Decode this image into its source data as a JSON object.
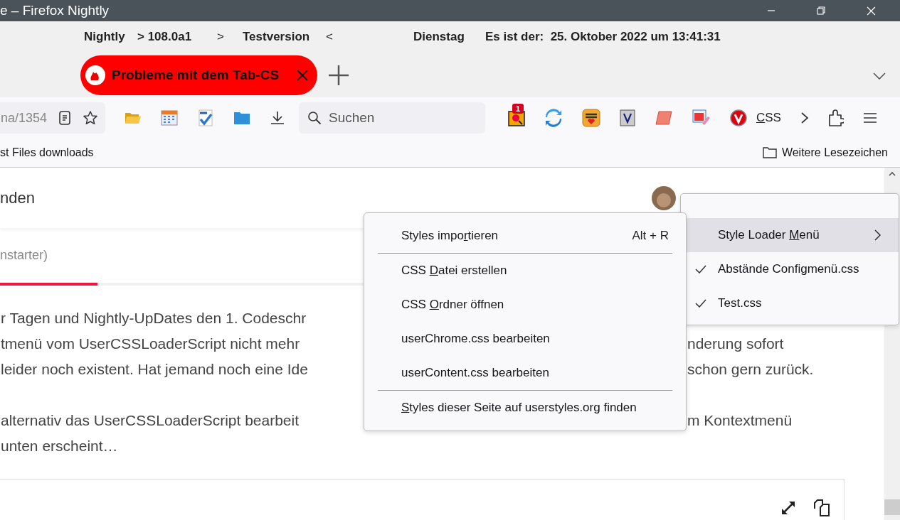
{
  "window": {
    "title": "e – Firefox Nightly"
  },
  "info_bar": {
    "items": [
      "Nightly",
      "> 108.0a1",
      ">",
      "Testversion",
      "<",
      "Dienstag",
      "Es ist der:  25. Oktober 2022 um 13:41:31"
    ]
  },
  "tabs": [
    {
      "title": "Probleme mit dem Tab-CS",
      "selected": true
    }
  ],
  "toolbar": {
    "url_fragment": "na/1354",
    "search_placeholder": "Suchen",
    "badge": "1",
    "extension_accesskey": "C",
    "extension_label_after": "SS"
  },
  "bookmarks": {
    "left": "st Files downloads",
    "right": "Weitere Lesezeichen"
  },
  "page": {
    "heading": "nden",
    "subtitle": "nstarter)",
    "paragraphs": [
      [
        {
          "left": "r Tagen und Nightly-UpDates den 1. Codeschr"
        },
        {
          "left": "tmenü vom UserCSSLoaderScript nicht mehr",
          "right": "nderung sofort"
        },
        {
          "left": "leider noch existent. Hat jemand noch eine Ide",
          "right": "schon gern zurück."
        }
      ],
      [
        {
          "left": "alternativ das UserCSSLoaderScript bearbeit",
          "right": "m Kontextmenü"
        },
        {
          "left": "unten erscheint…"
        }
      ]
    ]
  },
  "context_menu": {
    "items": [
      {
        "kind": "item",
        "label_before": "Styles impo",
        "accesskey": "r",
        "label_after": "tieren",
        "shortcut": "Alt + R"
      },
      {
        "kind": "separator"
      },
      {
        "kind": "item",
        "label_before": "CSS ",
        "accesskey": "D",
        "label_after": "atei erstellen"
      },
      {
        "kind": "item",
        "label_before": "CSS ",
        "accesskey": "O",
        "label_after": "rdner öffnen"
      },
      {
        "kind": "item",
        "label_after": "userChrome.css bearbeiten"
      },
      {
        "kind": "item",
        "label_after": "userContent.css bearbeiten"
      },
      {
        "kind": "separator"
      },
      {
        "kind": "item",
        "accesskey": "S",
        "label_after": "tyles dieser Seite auf userstyles.org finden"
      }
    ]
  },
  "style_menu": {
    "items": [
      {
        "kind": "submenu",
        "label_before": "Style Loader ",
        "accesskey": "M",
        "label_after": "enü",
        "selected": true
      },
      {
        "kind": "check",
        "label": "Abstände Configmenü.css",
        "checked": true
      },
      {
        "kind": "check",
        "label": "Test.css",
        "checked": true
      }
    ]
  }
}
